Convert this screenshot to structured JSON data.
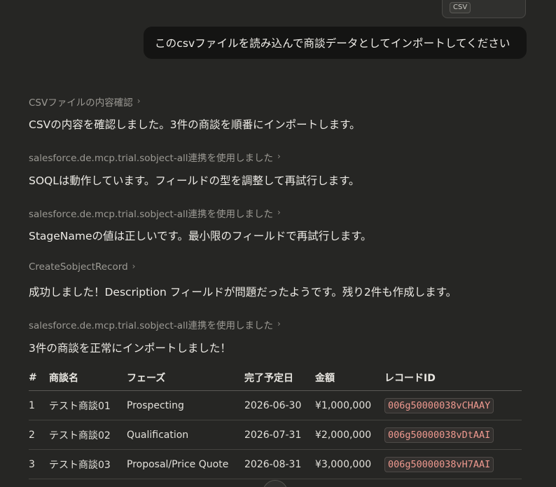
{
  "attachment": {
    "badge": "CSV"
  },
  "user_message": "このcsvファイルを読み込んで商談データとしてインポートしてください",
  "steps": [
    {
      "tool": "CSVファイルの内容確認",
      "message": "CSVの内容を確認しました。3件の商談を順番にインポートします。"
    },
    {
      "tool": "salesforce.de.mcp.trial.sobject-all連携を使用しました",
      "message": "SOQLは動作しています。フィールドの型を調整して再試行します。"
    },
    {
      "tool": "salesforce.de.mcp.trial.sobject-all連携を使用しました",
      "message": "StageNameの値は正しいです。最小限のフィールドで再試行します。"
    },
    {
      "tool": "CreateSobjectRecord",
      "message": "成功しました！Description フィールドが問題だったようです。残り2件も作成します。"
    },
    {
      "tool": "salesforce.de.mcp.trial.sobject-all連携を使用しました",
      "message": "3件の商談を正常にインポートしました！"
    }
  ],
  "table": {
    "headers": [
      "#",
      "商談名",
      "フェーズ",
      "完了予定日",
      "金額",
      "レコードID"
    ],
    "rows": [
      [
        "1",
        "テスト商談01",
        "Prospecting",
        "2026-06-30",
        "¥1,000,000",
        "006g50000038vCHAAY"
      ],
      [
        "2",
        "テスト商談02",
        "Qualification",
        "2026-07-31",
        "¥2,000,000",
        "006g50000038vDtAAI"
      ],
      [
        "3",
        "テスト商談03",
        "Proposal/Price Quote",
        "2026-08-31",
        "¥3,000,000",
        "006g50000038vH7AAI"
      ]
    ]
  },
  "icons": {
    "tool_chevron": "chevron-right-icon",
    "scroll_button": "scroll-down-button"
  }
}
